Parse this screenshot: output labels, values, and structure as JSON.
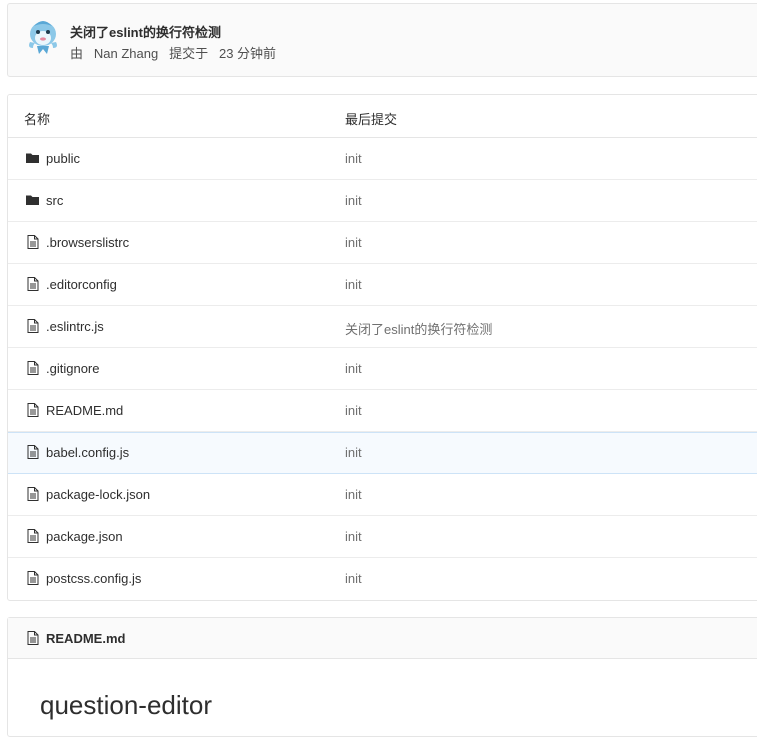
{
  "last_commit": {
    "title": "关闭了eslint的换行符检测",
    "prefix": "由",
    "author": "Nan Zhang",
    "action": "提交于",
    "time_ago": "23 分钟前",
    "avatar_icon": "dolphin-avatar"
  },
  "tree": {
    "headers": {
      "name": "名称",
      "last_commit": "最后提交"
    },
    "rows": [
      {
        "type": "folder",
        "icon": "folder-icon",
        "name": "public",
        "commit": "init"
      },
      {
        "type": "folder",
        "icon": "folder-icon",
        "name": "src",
        "commit": "init"
      },
      {
        "type": "file",
        "icon": "file-icon",
        "name": ".browserslistrc",
        "commit": "init"
      },
      {
        "type": "file",
        "icon": "file-icon",
        "name": ".editorconfig",
        "commit": "init"
      },
      {
        "type": "file",
        "icon": "file-icon",
        "name": ".eslintrc.js",
        "commit": "关闭了eslint的换行符检测"
      },
      {
        "type": "file",
        "icon": "file-icon",
        "name": ".gitignore",
        "commit": "init"
      },
      {
        "type": "file",
        "icon": "file-icon",
        "name": "README.md",
        "commit": "init"
      },
      {
        "type": "file",
        "icon": "file-icon",
        "name": "babel.config.js",
        "commit": "init"
      },
      {
        "type": "file",
        "icon": "file-icon",
        "name": "package-lock.json",
        "commit": "init"
      },
      {
        "type": "file",
        "icon": "file-icon",
        "name": "package.json",
        "commit": "init"
      },
      {
        "type": "file",
        "icon": "file-icon",
        "name": "postcss.config.js",
        "commit": "init"
      }
    ]
  },
  "readme": {
    "filename": "README.md",
    "heading": "question-editor"
  },
  "colors": {
    "border": "#e5e5e5",
    "hover_row_bg": "#f6fafe",
    "hover_row_border": "#cde3f7",
    "text": "#2e2e2e",
    "muted_text": "#707070"
  }
}
